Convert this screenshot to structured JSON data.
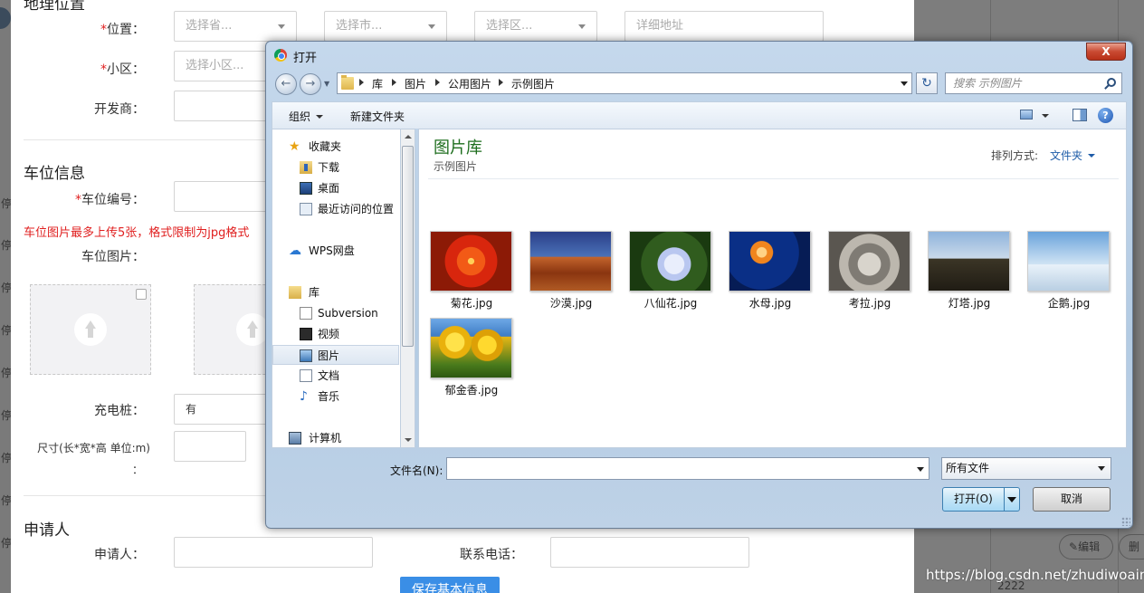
{
  "background_form": {
    "section_location_title": "地理位置",
    "location_label": "位置：",
    "community_label": "小区：",
    "developer_label": "开发商：",
    "province_placeholder": "选择省...",
    "city_placeholder": "选择市...",
    "district_placeholder": "选择区...",
    "address_placeholder": "详细地址",
    "community_placeholder": "选择小区...",
    "section_parking_title": "车位信息",
    "parking_number_label": "车位编号：",
    "upload_warning": "车位图片最多上传5张，格式限制为jpg格式",
    "parking_image_label": "车位图片：",
    "charging_label": "充电桩：",
    "charging_value": "有",
    "size_label": "尺寸(长*宽*高 单位:m)",
    "size_label_suffix": "：",
    "section_applicant_title": "申请人",
    "applicant_label": "申请人：",
    "phone_label": "联系电话：",
    "save_button": "保存基本信息",
    "required_mark": "*"
  },
  "background_right": {
    "edit_label": "编辑",
    "delete_label": "删",
    "row_value": "2222"
  },
  "left_stub_char": "停",
  "dialog": {
    "title": "打开",
    "close_label": "X",
    "breadcrumb": [
      "库",
      "图片",
      "公用图片",
      "示例图片"
    ],
    "search_placeholder": "搜索 示例图片",
    "toolbar": {
      "organize": "组织",
      "new_folder": "新建文件夹",
      "help": "?"
    },
    "nav_items": [
      {
        "label": "收藏夹",
        "icon": "star-icon"
      },
      {
        "label": "下载",
        "icon": "download-folder-icon"
      },
      {
        "label": "桌面",
        "icon": "desktop-icon"
      },
      {
        "label": "最近访问的位置",
        "icon": "recent-places-icon"
      },
      {
        "label": "WPS网盘",
        "icon": "cloud-icon"
      },
      {
        "label": "库",
        "icon": "library-icon"
      },
      {
        "label": "Subversion",
        "icon": "subversion-icon"
      },
      {
        "label": "视频",
        "icon": "video-icon"
      },
      {
        "label": "图片",
        "icon": "pictures-icon"
      },
      {
        "label": "文档",
        "icon": "documents-icon"
      },
      {
        "label": "音乐",
        "icon": "music-icon"
      },
      {
        "label": "计算机",
        "icon": "computer-icon"
      }
    ],
    "selected_nav": "图片",
    "library_title": "图片库",
    "library_subtitle": "示例图片",
    "sort_label": "排列方式:",
    "sort_value": "文件夹",
    "files": [
      {
        "name": "菊花.jpg"
      },
      {
        "name": "沙漠.jpg"
      },
      {
        "name": "八仙花.jpg"
      },
      {
        "name": "水母.jpg"
      },
      {
        "name": "考拉.jpg"
      },
      {
        "name": "灯塔.jpg"
      },
      {
        "name": "企鹅.jpg"
      },
      {
        "name": "郁金香.jpg"
      }
    ],
    "filename_label": "文件名(N):",
    "filename_value": "",
    "filter_value": "所有文件",
    "open_button": "打开(O)",
    "cancel_button": "取消"
  },
  "watermark": "https://blog.csdn.net/zhudiwoaini"
}
